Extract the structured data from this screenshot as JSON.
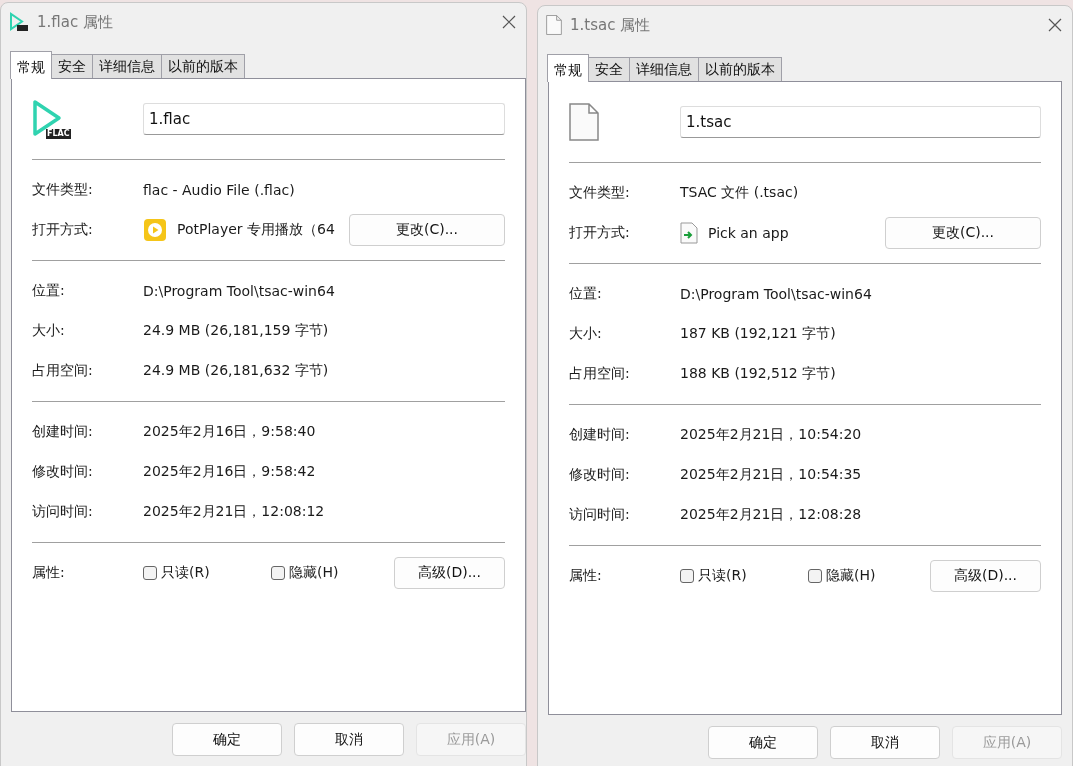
{
  "dialogs": [
    {
      "title": "1.flac 属性",
      "kind": "flac",
      "icon_label": "FLAC",
      "tabs": [
        {
          "label": "常规",
          "selected": true
        },
        {
          "label": "安全",
          "selected": false
        },
        {
          "label": "详细信息",
          "selected": false
        },
        {
          "label": "以前的版本",
          "selected": false
        }
      ],
      "filename": "1.flac",
      "groups": [
        {
          "rows": [
            {
              "kind": "text",
              "label": "文件类型:",
              "value": "flac - Audio File (.flac)"
            },
            {
              "kind": "app",
              "label": "打开方式:",
              "value": "PotPlayer 专用播放（64",
              "button": "更改(C)..."
            }
          ]
        },
        {
          "rows": [
            {
              "kind": "text",
              "label": "位置:",
              "value": "D:\\Program Tool\\tsac-win64"
            },
            {
              "kind": "text",
              "label": "大小:",
              "value": "24.9 MB (26,181,159 字节)"
            },
            {
              "kind": "text",
              "label": "占用空间:",
              "value": "24.9 MB (26,181,632 字节)"
            }
          ]
        },
        {
          "rows": [
            {
              "kind": "text",
              "label": "创建时间:",
              "value": "2025年2月16日，9:58:40"
            },
            {
              "kind": "text",
              "label": "修改时间:",
              "value": "2025年2月16日，9:58:42"
            },
            {
              "kind": "text",
              "label": "访问时间:",
              "value": "2025年2月21日，12:08:12"
            }
          ]
        },
        {
          "rows": [
            {
              "kind": "attributes",
              "label": "属性:",
              "checkboxes": [
                {
                  "label": "只读(R)",
                  "checked": false
                },
                {
                  "label": "隐藏(H)",
                  "checked": false
                }
              ],
              "button": "高级(D)..."
            }
          ]
        }
      ],
      "buttons": [
        {
          "label": "确定",
          "disabled": false
        },
        {
          "label": "取消",
          "disabled": false
        },
        {
          "label": "应用(A)",
          "disabled": true
        }
      ]
    },
    {
      "title": "1.tsac 属性",
      "kind": "document",
      "tabs": [
        {
          "label": "常规",
          "selected": true
        },
        {
          "label": "安全",
          "selected": false
        },
        {
          "label": "详细信息",
          "selected": false
        },
        {
          "label": "以前的版本",
          "selected": false
        }
      ],
      "filename": "1.tsac",
      "groups": [
        {
          "rows": [
            {
              "kind": "text",
              "label": "文件类型:",
              "value": "TSAC 文件 (.tsac)"
            },
            {
              "kind": "picker",
              "label": "打开方式:",
              "value": "Pick an app",
              "button": "更改(C)..."
            }
          ]
        },
        {
          "rows": [
            {
              "kind": "text",
              "label": "位置:",
              "value": "D:\\Program Tool\\tsac-win64"
            },
            {
              "kind": "text",
              "label": "大小:",
              "value": "187 KB (192,121 字节)"
            },
            {
              "kind": "text",
              "label": "占用空间:",
              "value": "188 KB (192,512 字节)"
            }
          ]
        },
        {
          "rows": [
            {
              "kind": "text",
              "label": "创建时间:",
              "value": "2025年2月21日，10:54:20"
            },
            {
              "kind": "text",
              "label": "修改时间:",
              "value": "2025年2月21日，10:54:35"
            },
            {
              "kind": "text",
              "label": "访问时间:",
              "value": "2025年2月21日，12:08:28"
            }
          ]
        },
        {
          "rows": [
            {
              "kind": "attributes",
              "label": "属性:",
              "checkboxes": [
                {
                  "label": "只读(R)",
                  "checked": false
                },
                {
                  "label": "隐藏(H)",
                  "checked": false
                }
              ],
              "button": "高级(D)..."
            }
          ]
        }
      ],
      "buttons": [
        {
          "label": "确定",
          "disabled": false
        },
        {
          "label": "取消",
          "disabled": false
        },
        {
          "label": "应用(A)",
          "disabled": true
        }
      ]
    }
  ]
}
